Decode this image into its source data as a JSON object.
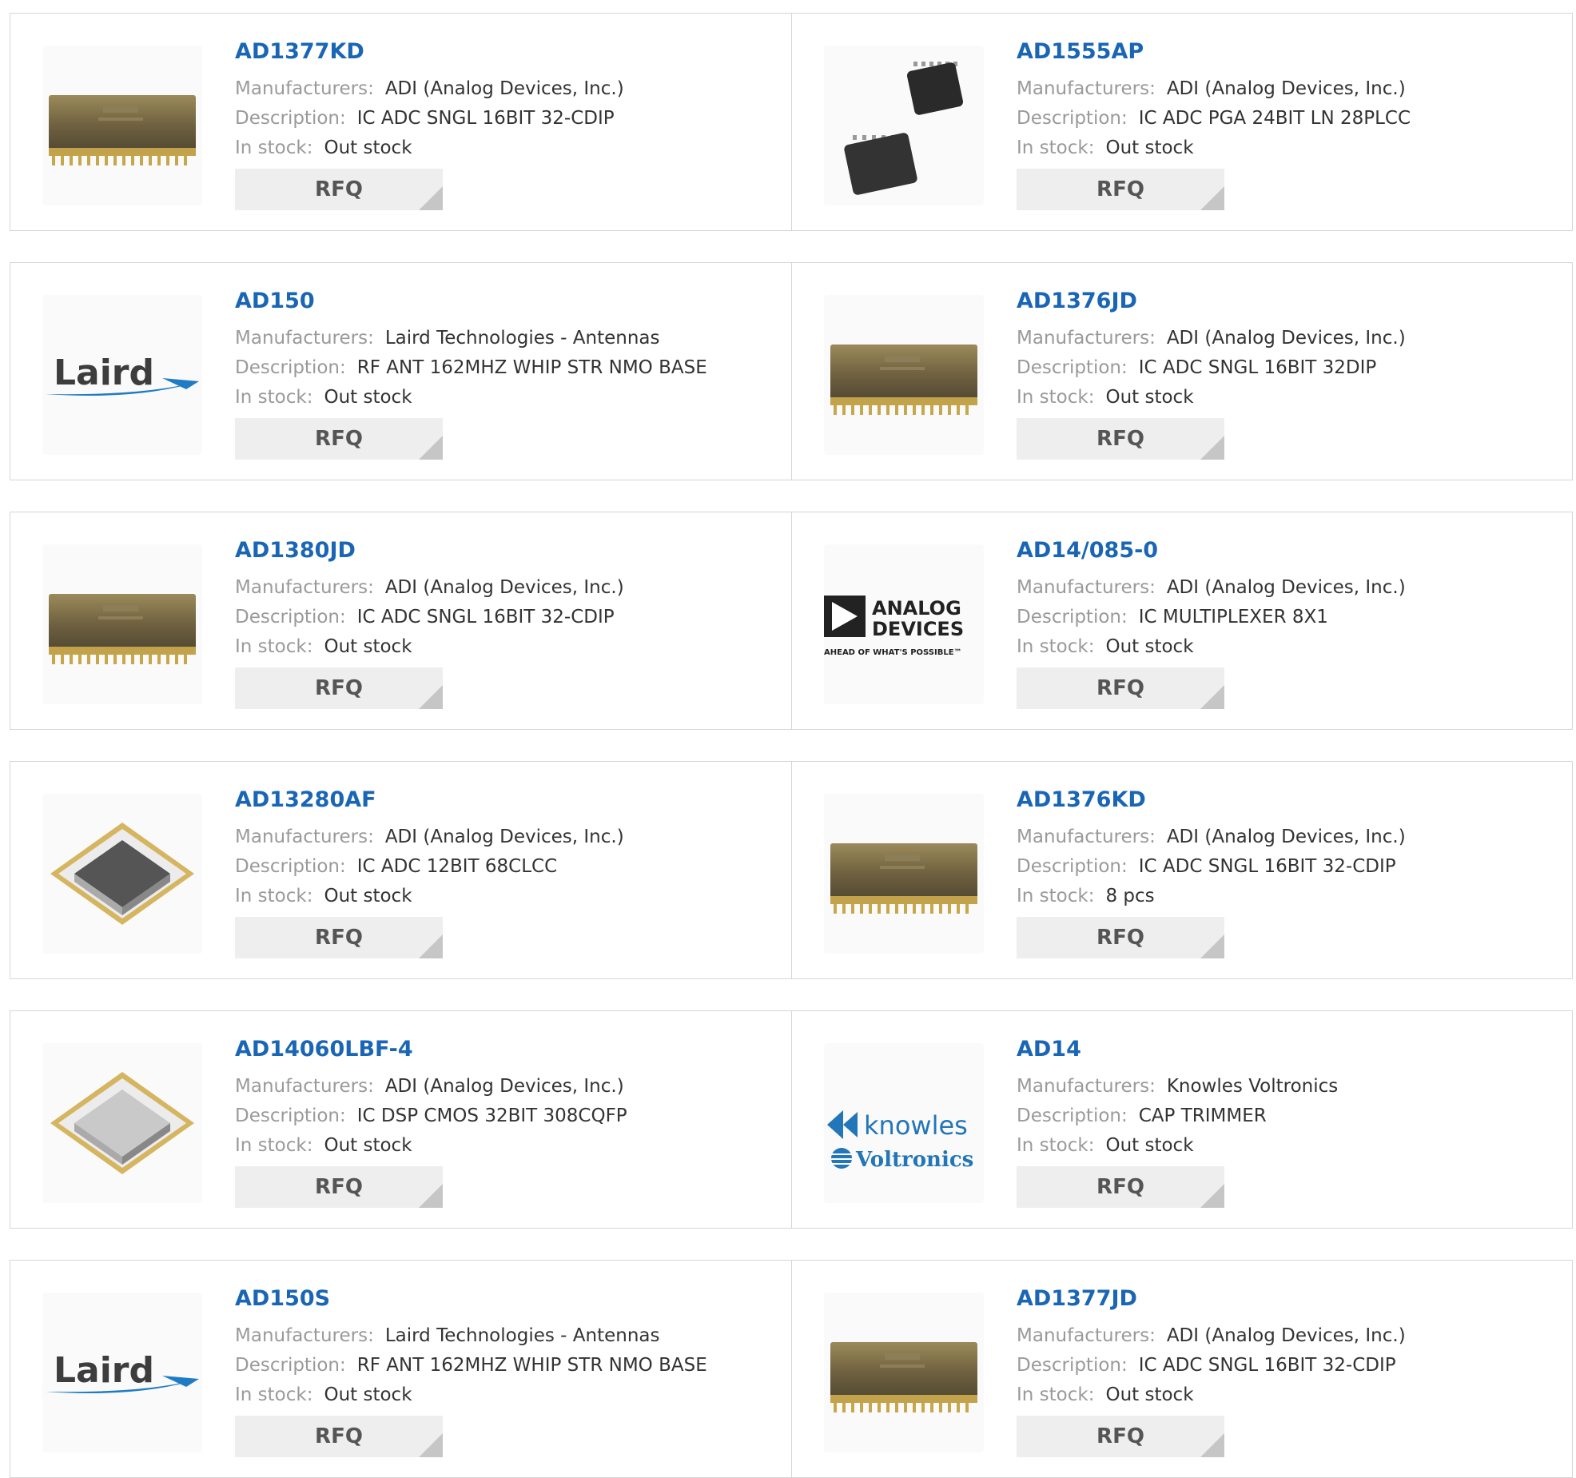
{
  "labels": {
    "manufacturers": "Manufacturers:",
    "description": "Description:",
    "stock": "In stock:",
    "rfq": "RFQ"
  },
  "products": [
    {
      "part": "AD1377KD",
      "manufacturer": "ADI (Analog Devices, Inc.)",
      "description": "IC ADC SNGL 16BIT 32-CDIP",
      "stock": "Out stock",
      "image": "dip-chip"
    },
    {
      "part": "AD1555AP",
      "manufacturer": "ADI (Analog Devices, Inc.)",
      "description": "IC ADC PGA 24BIT LN 28PLCC",
      "stock": "Out stock",
      "image": "plcc-chip"
    },
    {
      "part": "AD150",
      "manufacturer": "Laird Technologies - Antennas",
      "description": "RF ANT 162MHZ WHIP STR NMO BASE",
      "stock": "Out stock",
      "image": "laird-logo",
      "logo_text": "Laird"
    },
    {
      "part": "AD1376JD",
      "manufacturer": "ADI (Analog Devices, Inc.)",
      "description": "IC ADC SNGL 16BIT 32DIP",
      "stock": "Out stock",
      "image": "dip-chip"
    },
    {
      "part": "AD1380JD",
      "manufacturer": "ADI (Analog Devices, Inc.)",
      "description": "IC ADC SNGL 16BIT 32-CDIP",
      "stock": "Out stock",
      "image": "dip-chip"
    },
    {
      "part": "AD14/085-0",
      "manufacturer": "ADI (Analog Devices, Inc.)",
      "description": "IC MULTIPLEXER 8X1",
      "stock": "Out stock",
      "image": "analog-devices-logo",
      "logo_lines": [
        "ANALOG",
        "DEVICES",
        "AHEAD OF WHAT'S POSSIBLE™"
      ]
    },
    {
      "part": "AD13280AF",
      "manufacturer": "ADI (Analog Devices, Inc.)",
      "description": "IC ADC 12BIT 68CLCC",
      "stock": "Out stock",
      "image": "clcc-chip"
    },
    {
      "part": "AD1376KD",
      "manufacturer": "ADI (Analog Devices, Inc.)",
      "description": "IC ADC SNGL 16BIT 32-CDIP",
      "stock": "8 pcs",
      "image": "dip-chip"
    },
    {
      "part": "AD14060LBF-4",
      "manufacturer": "ADI (Analog Devices, Inc.)",
      "description": "IC DSP CMOS 32BIT 308CQFP",
      "stock": "Out stock",
      "image": "cqfp-chip"
    },
    {
      "part": "AD14",
      "manufacturer": "Knowles Voltronics",
      "description": "CAP TRIMMER",
      "stock": "Out stock",
      "image": "knowles-voltronics-logo",
      "logo_lines": [
        "knowles",
        "Voltronics"
      ]
    },
    {
      "part": "AD150S",
      "manufacturer": "Laird Technologies - Antennas",
      "description": "RF ANT 162MHZ WHIP STR NMO BASE",
      "stock": "Out stock",
      "image": "laird-logo",
      "logo_text": "Laird"
    },
    {
      "part": "AD1377JD",
      "manufacturer": "ADI (Analog Devices, Inc.)",
      "description": "IC ADC SNGL 16BIT 32-CDIP",
      "stock": "Out stock",
      "image": "dip-chip"
    }
  ]
}
